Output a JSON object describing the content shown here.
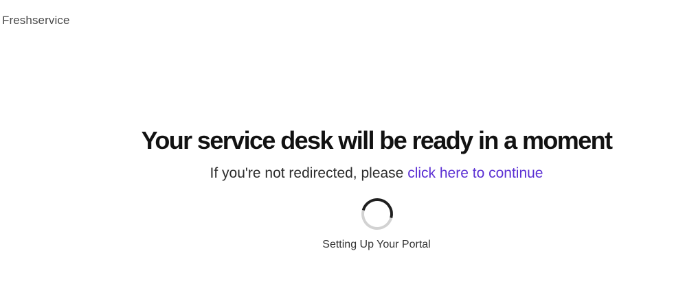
{
  "header": {
    "brand": "Freshservice"
  },
  "main": {
    "headline": "Your service desk will be ready in a moment",
    "redirect_prefix": "If you're not redirected, please ",
    "redirect_link": "click here to continue",
    "status": "Setting Up Your Portal",
    "spinner_icon": "loading-spinner-icon"
  },
  "colors": {
    "link": "#5b2fd3",
    "headline": "#121212",
    "spinner_track": "#d2d2d2",
    "spinner_arc": "#1f1f1f"
  }
}
